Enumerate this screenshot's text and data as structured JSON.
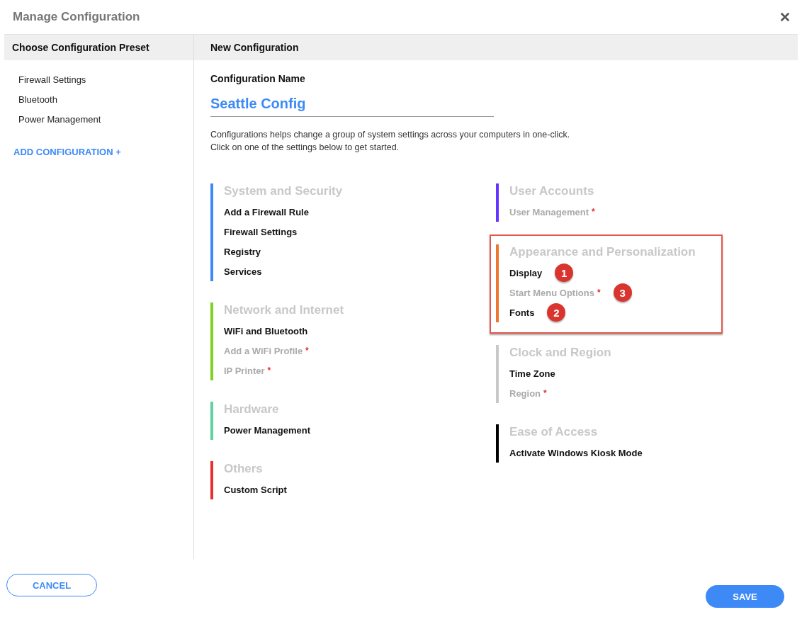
{
  "dialog": {
    "title": "Manage Configuration"
  },
  "sidebar": {
    "heading": "Choose Configuration Preset",
    "items": [
      {
        "label": "Firewall Settings"
      },
      {
        "label": "Bluetooth"
      },
      {
        "label": "Power Management"
      }
    ],
    "add_link": "ADD CONFIGURATION +"
  },
  "main": {
    "heading": "New Configuration",
    "name_label": "Configuration Name",
    "name_value": "Seattle Config",
    "description": [
      "Configurations helps change a group of system settings across your computers in one-click.",
      "Click on one of the settings below to get started."
    ],
    "columns": [
      [
        {
          "title": "System and Security",
          "color": "#3d8af7",
          "highlighted": false,
          "items": [
            {
              "label": "Add a Firewall Rule",
              "disabled": false
            },
            {
              "label": "Firewall Settings",
              "disabled": false
            },
            {
              "label": "Registry",
              "disabled": false
            },
            {
              "label": "Services",
              "disabled": false
            }
          ]
        },
        {
          "title": "Network and Internet",
          "color": "#7ed321",
          "highlighted": false,
          "items": [
            {
              "label": "WiFi and Bluetooth",
              "disabled": false
            },
            {
              "label": "Add a WiFi Profile",
              "disabled": true,
              "mark": "*"
            },
            {
              "label": "IP Printer",
              "disabled": true,
              "mark": "*"
            }
          ]
        },
        {
          "title": "Hardware",
          "color": "#5dd39e",
          "highlighted": false,
          "items": [
            {
              "label": "Power Management",
              "disabled": false
            }
          ]
        },
        {
          "title": "Others",
          "color": "#e8302a",
          "highlighted": false,
          "items": [
            {
              "label": "Custom Script",
              "disabled": false
            }
          ]
        }
      ],
      [
        {
          "title": "User Accounts",
          "color": "#6236ff",
          "highlighted": false,
          "items": [
            {
              "label": "User Management",
              "disabled": true,
              "mark": "*"
            }
          ]
        },
        {
          "title": "Appearance and Personalization",
          "color": "#ee7630",
          "highlighted": true,
          "items": [
            {
              "label": "Display",
              "disabled": false,
              "badge": "1"
            },
            {
              "label": "Start Menu Options",
              "disabled": true,
              "mark": "*",
              "badge": "3"
            },
            {
              "label": "Fonts",
              "disabled": false,
              "badge": "2"
            }
          ]
        },
        {
          "title": "Clock and Region",
          "color": "#c8c8c8",
          "highlighted": false,
          "items": [
            {
              "label": "Time Zone",
              "disabled": false
            },
            {
              "label": "Region",
              "disabled": true,
              "mark": "*"
            }
          ]
        },
        {
          "title": "Ease of Access",
          "color": "#000000",
          "highlighted": false,
          "items": [
            {
              "label": "Activate Windows Kiosk Mode",
              "disabled": false
            }
          ]
        }
      ]
    ]
  },
  "buttons": {
    "cancel": "CANCEL",
    "save": "SAVE"
  }
}
